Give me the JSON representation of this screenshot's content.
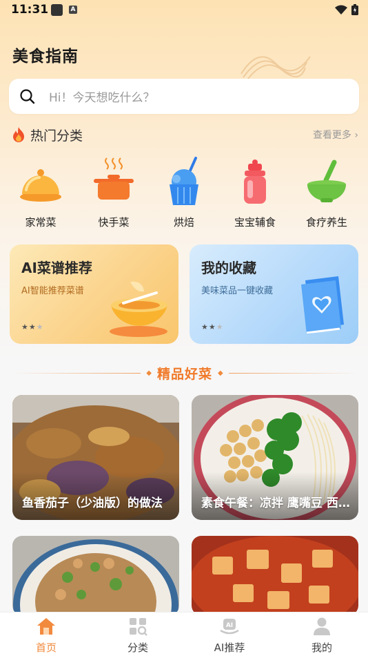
{
  "status_bar": {
    "time": "11:31",
    "ic_badge": "A"
  },
  "app": {
    "title": "美食指南"
  },
  "search": {
    "placeholder": "Hi！今天想吃什么？"
  },
  "hot": {
    "title": "热门分类",
    "more": "查看更多 ›"
  },
  "categories": [
    {
      "label": "家常菜",
      "icon": "cloche-icon"
    },
    {
      "label": "快手菜",
      "icon": "pot-icon"
    },
    {
      "label": "烘焙",
      "icon": "cupcake-icon"
    },
    {
      "label": "宝宝辅食",
      "icon": "baby-bottle-icon"
    },
    {
      "label": "食疗养生",
      "icon": "mortar-bowl-icon"
    }
  ],
  "features": [
    {
      "title": "AI菜谱推荐",
      "subtitle": "AI智能推荐菜谱",
      "rating": 2,
      "max": 3
    },
    {
      "title": "我的收藏",
      "subtitle": "美味菜品一键收藏",
      "rating": 2,
      "max": 3
    }
  ],
  "section": {
    "title": "精品好菜"
  },
  "recipes": [
    {
      "title": "鱼香茄子（少油版）的做法"
    },
    {
      "title": "素食午餐：凉拌 鹰嘴豆 西蓝花"
    },
    {
      "title": ""
    },
    {
      "title": ""
    }
  ],
  "tabs": [
    {
      "label": "首页",
      "active": true
    },
    {
      "label": "分类",
      "active": false
    },
    {
      "label": "AI推荐",
      "active": false
    },
    {
      "label": "我的",
      "active": false
    }
  ],
  "colors": {
    "accent": "#f0883a",
    "feature_ai": "#fbd38c",
    "feature_fav": "#b6dafb"
  }
}
